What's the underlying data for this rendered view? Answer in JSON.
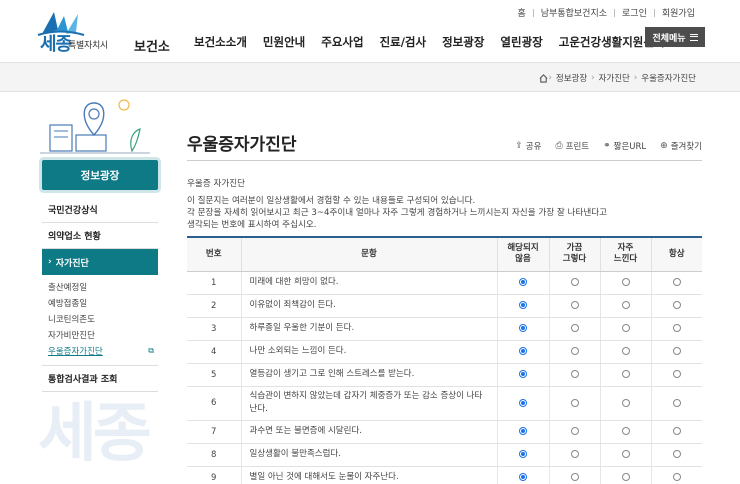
{
  "util_links": [
    "홈",
    "남부통합보건지소",
    "로그인",
    "회원가입"
  ],
  "logo": {
    "sejong": "세종",
    "city": "특별자치시",
    "org": "보건소"
  },
  "gnb": [
    "보건소소개",
    "민원안내",
    "주요사업",
    "진료/검사",
    "정보광장",
    "열린광장",
    "고운건강생활지원센터"
  ],
  "allmenu_label": "전체메뉴",
  "breadcrumb": [
    "정보광장",
    "자가진단",
    "우울증자가진단"
  ],
  "sidebar": {
    "title": "정보광장",
    "items": [
      {
        "label": "국민건강상식"
      },
      {
        "label": "의약업소 현황"
      },
      {
        "label": "자가진단",
        "active": true,
        "sub": [
          "출산예정일",
          "예방접종일",
          "니코틴의존도",
          "자가비만진단",
          "우울증자가진단"
        ]
      },
      {
        "label": "통합검사결과 조회"
      }
    ]
  },
  "watermark": "세종",
  "page_title": "우울증자가진단",
  "tools": [
    "공유",
    "프린트",
    "짧은URL",
    "즐겨찾기"
  ],
  "desc": {
    "heading": "우울증 자가진단",
    "lines": [
      "이 질문지는 여러분이 일상생활에서 경험할 수 있는 내용들로 구성되어 있습니다.",
      "각 문장을 자세히 읽어보시고 최근 3~4주이내 얼마나 자주 그렇게 경험하거나 느끼시는지 자신을 가장 잘 나타낸다고",
      "생각되는 번호에 표시하여 주십시오."
    ]
  },
  "table": {
    "headers": [
      "번호",
      "문항",
      "해당되지 않음",
      "가끔 그렇다",
      "자주 느낀다",
      "항상"
    ],
    "rows": [
      {
        "no": "1",
        "q": "미래에 대한 희망이 없다."
      },
      {
        "no": "2",
        "q": "이유없이 죄책감이 든다."
      },
      {
        "no": "3",
        "q": "하루종일 우울한 기분이 든다."
      },
      {
        "no": "4",
        "q": "나만 소외되는 느낌이 든다."
      },
      {
        "no": "5",
        "q": "열등감이 생기고 그로 인해 스트레스를 받는다."
      },
      {
        "no": "6",
        "q": "식습관이 변하지 않았는데 갑자기 체중증가 또는 감소 증상이 나타난다."
      },
      {
        "no": "7",
        "q": "과수면 또는 불면증에 시달린다."
      },
      {
        "no": "8",
        "q": "일상생활이 불만족스럽다."
      },
      {
        "no": "9",
        "q": "별일 아닌 것에 대해서도 눈물이 자주난다."
      }
    ],
    "selected_option": "해당되지 않음"
  }
}
